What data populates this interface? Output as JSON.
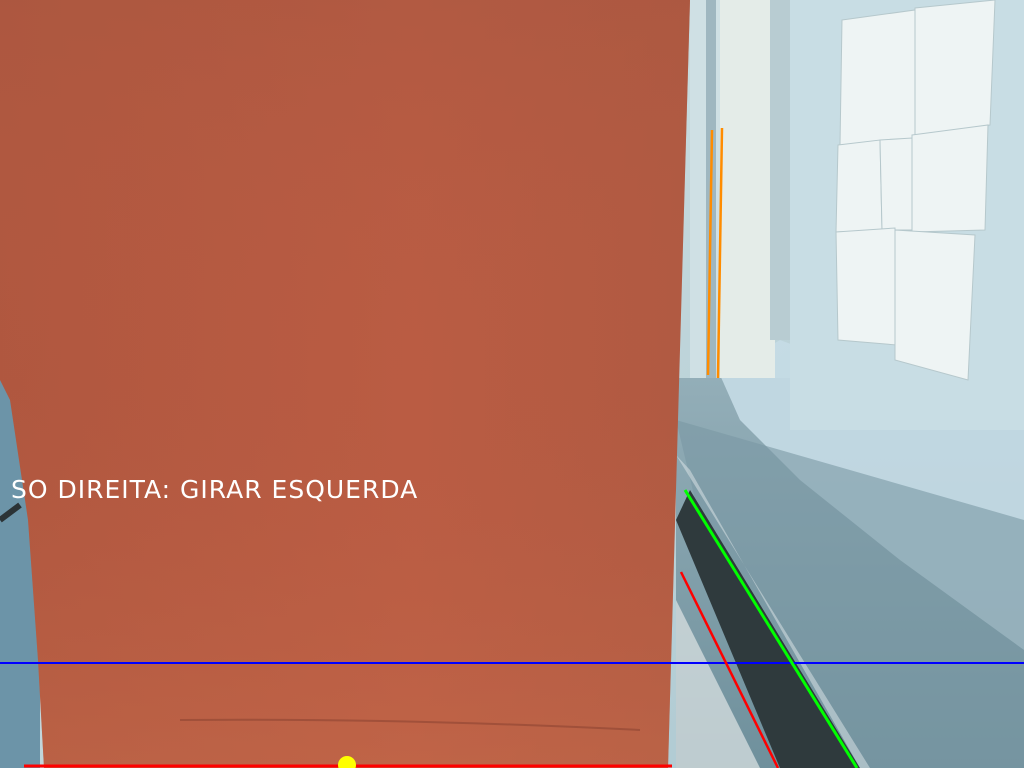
{
  "overlay": {
    "status_text": "SO DIREITA: GIRAR ESQUERDA"
  },
  "colors": {
    "box": "#b75a40",
    "left_lane_line": "#ff0000",
    "right_lane_line": "#00ff00",
    "horizon_line": "#0000ff",
    "edge_lines": "#ff8c00",
    "center_marker": "#ffff00"
  }
}
